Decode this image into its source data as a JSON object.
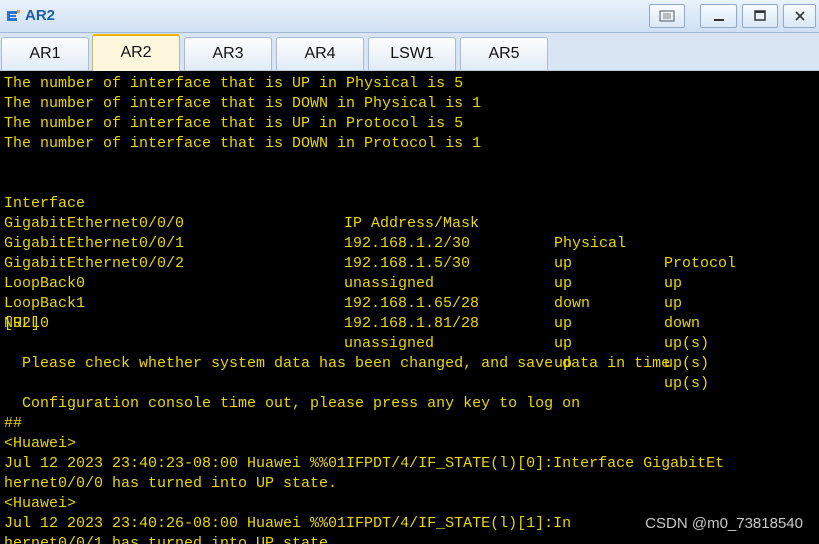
{
  "window": {
    "title": "AR2",
    "icon": "ensp-app-icon",
    "controls": [
      "restore-icon",
      "minimize-icon",
      "maximize-icon",
      "close-icon"
    ]
  },
  "tabs": [
    {
      "label": "AR1",
      "active": false
    },
    {
      "label": "AR2",
      "active": true
    },
    {
      "label": "AR3",
      "active": false
    },
    {
      "label": "AR4",
      "active": false
    },
    {
      "label": "LSW1",
      "active": false
    },
    {
      "label": "AR5",
      "active": false
    }
  ],
  "console": {
    "summary": [
      "The number of interface that is UP in Physical is 5",
      "The number of interface that is DOWN in Physical is 1",
      "The number of interface that is UP in Protocol is 5",
      "The number of interface that is DOWN in Protocol is 1"
    ],
    "table_headers": [
      "Interface",
      "IP Address/Mask",
      "Physical",
      "Protocol"
    ],
    "table_rows": [
      [
        "GigabitEthernet0/0/0",
        "192.168.1.2/30",
        "up",
        "up"
      ],
      [
        "GigabitEthernet0/0/1",
        "192.168.1.5/30",
        "up",
        "up"
      ],
      [
        "GigabitEthernet0/0/2",
        "unassigned",
        "down",
        "down"
      ],
      [
        "LoopBack0",
        "192.168.1.65/28",
        "up",
        "up(s)"
      ],
      [
        "LoopBack1",
        "192.168.1.81/28",
        "up",
        "up(s)"
      ],
      [
        "NULL0",
        "unassigned",
        "up",
        "up(s)"
      ]
    ],
    "prompt": "[R2]",
    "save_notice": "  Please check whether system data has been changed, and save data in time",
    "timeout_notice": "  Configuration console time out, please press any key to log on",
    "hashes": "##",
    "huawei_prompt_1": "<Huawei>",
    "log_1a": "Jul 12 2023 23:40:23-08:00 Huawei %%01IFPDT/4/IF_STATE(l)[0]:Interface GigabitEt",
    "log_1b": "hernet0/0/0 has turned into UP state.",
    "huawei_prompt_2": "<Huawei>",
    "log_2a": "Jul 12 2023 23:40:26-08:00 Huawei %%01IFPDT/4/IF_STATE(l)[1]:In",
    "log_2b": "hernet0/0/1 has turned into UP state."
  },
  "watermark": "CSDN @m0_73818540",
  "colors": {
    "console_bg": "#000000",
    "console_fg": "#e9d700",
    "title_fg": "#1c5ea8",
    "active_tab": "#fff8df"
  }
}
